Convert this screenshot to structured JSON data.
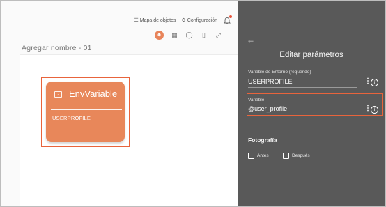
{
  "topnav": {
    "object_map_label": "Mapa de objetos",
    "settings_label": "Configuración"
  },
  "canvas": {
    "title": "Agregar nombre - 01"
  },
  "node": {
    "title": "EnvVariable",
    "value": "USERPROFILE"
  },
  "panel": {
    "back_icon": "←",
    "title": "Editar parámetros",
    "fields": [
      {
        "label": "Variable de Entorno (requerido)",
        "value": "USERPROFILE"
      },
      {
        "label": "Variable",
        "value": "@user_profile"
      }
    ],
    "section_title": "Fotografía",
    "checkboxes": [
      {
        "label": "Antes",
        "checked": false
      },
      {
        "label": "Después",
        "checked": false
      }
    ]
  },
  "colors": {
    "accent": "#e8643c",
    "card": "#e8875a",
    "panel_bg": "#595959"
  }
}
